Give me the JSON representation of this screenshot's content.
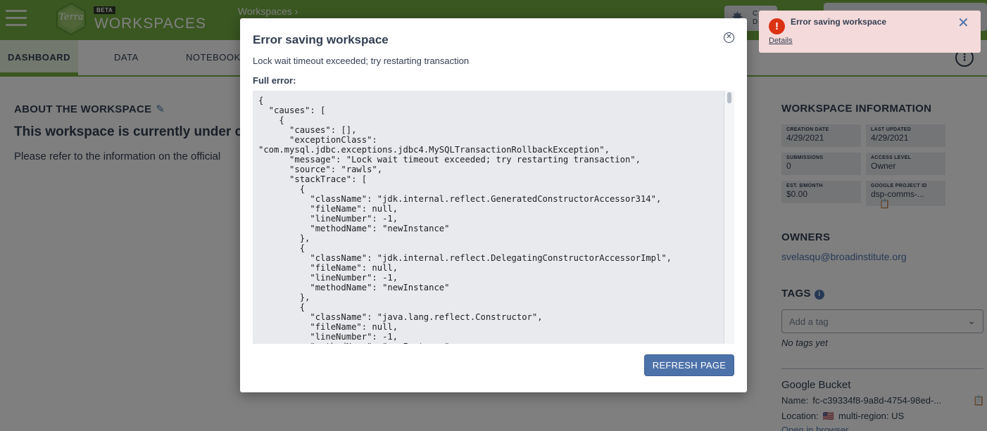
{
  "header": {
    "logo_text": "Terra",
    "beta": "BETA",
    "brand": "WORKSPACES",
    "breadcrumb": "Workspaces ›",
    "pill_text_1": "C",
    "pill_text_2": "D"
  },
  "tabs": [
    {
      "label": "DASHBOARD"
    },
    {
      "label": "DATA"
    },
    {
      "label": "NOTEBOOKS"
    }
  ],
  "main": {
    "about_heading": "ABOUT THE WORKSPACE",
    "title": "This workspace is currently under c",
    "text": "Please refer to the information on the official"
  },
  "right_panel": {
    "info_heading": "WORKSPACE INFORMATION",
    "info": [
      {
        "label": "CREATION DATE",
        "value": "4/29/2021"
      },
      {
        "label": "LAST UPDATED",
        "value": "4/29/2021"
      },
      {
        "label": "SUBMISSIONS",
        "value": "0"
      },
      {
        "label": "ACCESS LEVEL",
        "value": "Owner"
      },
      {
        "label": "EST. $/MONTH",
        "value": "$0.00"
      },
      {
        "label": "GOOGLE PROJECT ID",
        "value": "dsp-comms-..."
      }
    ],
    "owners_heading": "OWNERS",
    "owner_email": "svelasqu@broadinstitute.org",
    "tags_heading": "TAGS",
    "tag_placeholder": "Add a tag",
    "no_tags": "No tags yet",
    "bucket_heading": "Google Bucket",
    "bucket_name_label": "Name:",
    "bucket_name": "fc-c39334f8-9a8d-4754-98ed-...",
    "bucket_location_label": "Location:",
    "bucket_flag": "🇺🇸",
    "bucket_location": "multi-region: US",
    "open_browser": "Open in browser"
  },
  "modal": {
    "title": "Error saving workspace",
    "message": "Lock wait timeout exceeded; try restarting transaction",
    "full_error_label": "Full error:",
    "error_json": "{\n  \"causes\": [\n    {\n      \"causes\": [],\n      \"exceptionClass\":\n\"com.mysql.jdbc.exceptions.jdbc4.MySQLTransactionRollbackException\",\n      \"message\": \"Lock wait timeout exceeded; try restarting transaction\",\n      \"source\": \"rawls\",\n      \"stackTrace\": [\n        {\n          \"className\": \"jdk.internal.reflect.GeneratedConstructorAccessor314\",\n          \"fileName\": null,\n          \"lineNumber\": -1,\n          \"methodName\": \"newInstance\"\n        },\n        {\n          \"className\": \"jdk.internal.reflect.DelegatingConstructorAccessorImpl\",\n          \"fileName\": null,\n          \"lineNumber\": -1,\n          \"methodName\": \"newInstance\"\n        },\n        {\n          \"className\": \"java.lang.reflect.Constructor\",\n          \"fileName\": null,\n          \"lineNumber\": -1,\n          \"methodName\": \"newInstance\"",
    "refresh_label": "REFRESH PAGE"
  },
  "toast": {
    "title": "Error saving workspace",
    "details": "Details"
  },
  "colors": {
    "brand_green": "#74ae43",
    "link_blue": "#4d72aa",
    "error_red": "#db3214",
    "toast_bg": "#f4dada"
  }
}
